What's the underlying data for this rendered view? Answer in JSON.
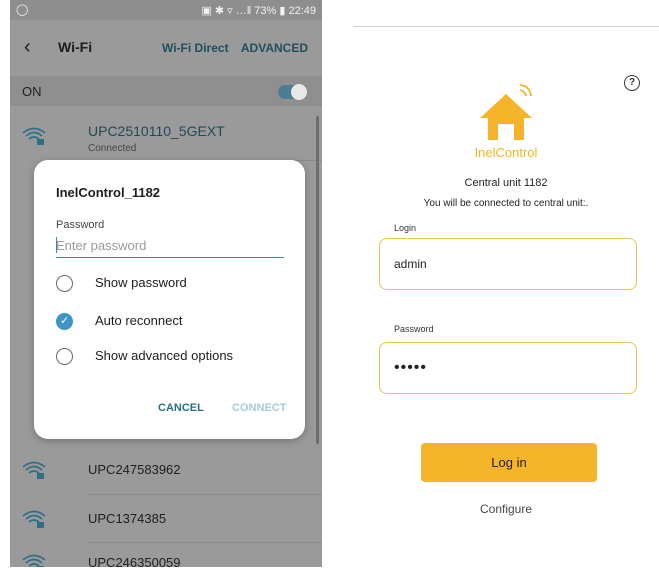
{
  "left_screen": {
    "status_bar": {
      "left_icon": "whatsapp-icon",
      "right": "▣ ✱ ▿ …‖ 73% ▮ 22:49"
    },
    "app_bar": {
      "title": "Wi-Fi",
      "wifi_direct": "Wi-Fi Direct",
      "advanced": "ADVANCED"
    },
    "switch": {
      "label": "ON",
      "state": "on"
    },
    "networks": [
      {
        "name": "UPC2510110_5GEXT",
        "status": "Connected"
      },
      {
        "name": "UPC247583962"
      },
      {
        "name": "UPC1374385"
      },
      {
        "name": "UPC246350059"
      }
    ],
    "dialog": {
      "title": "InelControl_1182",
      "password_label": "Password",
      "password_placeholder": "Enter password",
      "options": [
        {
          "label": "Show password",
          "checked": false
        },
        {
          "label": "Auto reconnect",
          "checked": true
        },
        {
          "label": "Show advanced options",
          "checked": false
        }
      ],
      "cancel": "CANCEL",
      "connect": "CONNECT"
    }
  },
  "right_screen": {
    "help_icon": "?",
    "brand": "InelControl",
    "central_unit": "Central unit 1182",
    "connect_note": "You will be connected to central unit:.",
    "login_label": "Login",
    "login_value": "admin",
    "password_label": "Password",
    "password_value": "•••••",
    "login_button": "Log in",
    "configure": "Configure"
  },
  "colors": {
    "accent_orange": "#f5b42a",
    "field_border": "#f1c356",
    "android_teal": "#2a6f88"
  }
}
